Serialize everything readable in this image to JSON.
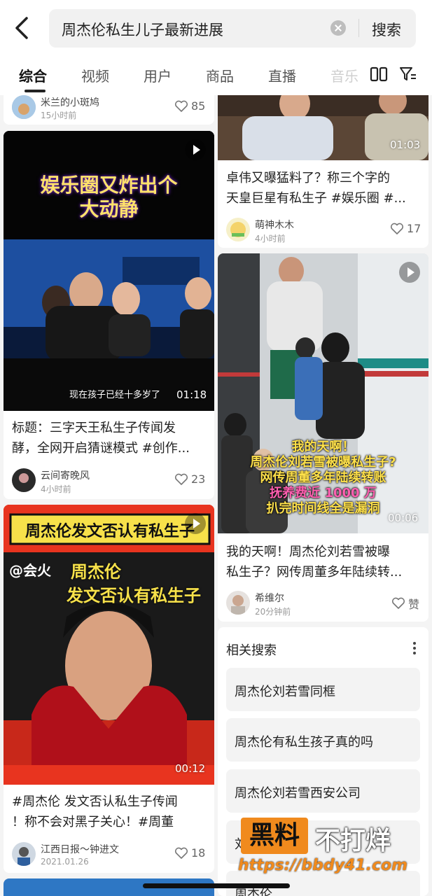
{
  "search": {
    "query": "周杰伦私生儿子最新进展",
    "button": "搜索"
  },
  "tabs": [
    "综合",
    "视频",
    "用户",
    "商品",
    "直播",
    "音乐"
  ],
  "left": {
    "card0": {
      "author": "米兰的小斑鸠",
      "time": "15小时前",
      "likes": "85"
    },
    "card1": {
      "overlay_line1": "娱乐圈又炸出个",
      "overlay_line2": "大动静",
      "caption": "现在孩子已经十多岁了",
      "duration": "01:18",
      "title": "标题：三字天王私生子传闻发酵，全网开启猜谜模式 #创作...",
      "title_l1": "标题：三字天王私生子传闻发",
      "title_l2": "酵，全网开启猜谜模式 #创作...",
      "author": "云间寄晚风",
      "time": "4小时前",
      "likes": "23"
    },
    "card2": {
      "banner": "周杰伦发文否认有私生子",
      "brand": "@会火",
      "overlay_line1": "周杰伦",
      "overlay_line2": "发文否认有私生子",
      "duration": "00:12",
      "title_l1": "#周杰伦 发文否认私生子传闻",
      "title_l2": "！称不会对黑子关心！#周董",
      "author": "江西日报～钟进文",
      "time": "2021.01.26",
      "likes": "18"
    }
  },
  "right": {
    "card0": {
      "duration": "01:03",
      "title_l1": "卓伟又曝猛料了？称三个字的",
      "title_l2": "天皇巨星有私生子 #娱乐圈 #...",
      "author": "萌神木木",
      "time": "4小时前",
      "likes": "17"
    },
    "card1": {
      "overlay": [
        "我的天啊！",
        "周杰伦刘若雪被曝私生子?",
        "网传周董多年陆续转账",
        "抚养费近 1000 万",
        "扒完时间线全是漏洞"
      ],
      "duration": "00:06",
      "title_l1": "我的天啊！周杰伦刘若雪被曝",
      "title_l2": "私生子？网传周董多年陆续转...",
      "author": "希维尔",
      "time": "20分钟前",
      "likes": "赞"
    }
  },
  "related": {
    "heading": "相关搜索",
    "items": [
      "周杰伦刘若雪同框",
      "周杰伦有私生孩子真的吗",
      "周杰伦刘若雪西安公司",
      "刘若雪",
      "周杰伦"
    ]
  },
  "watermark": {
    "box": "黑料",
    "rest": "不打烊",
    "url": "https://bbdy41.com"
  },
  "colors": {
    "accent_orange": "#f08a1d",
    "banner_red": "#e8341f",
    "banner_yellow": "#f7e14a"
  }
}
